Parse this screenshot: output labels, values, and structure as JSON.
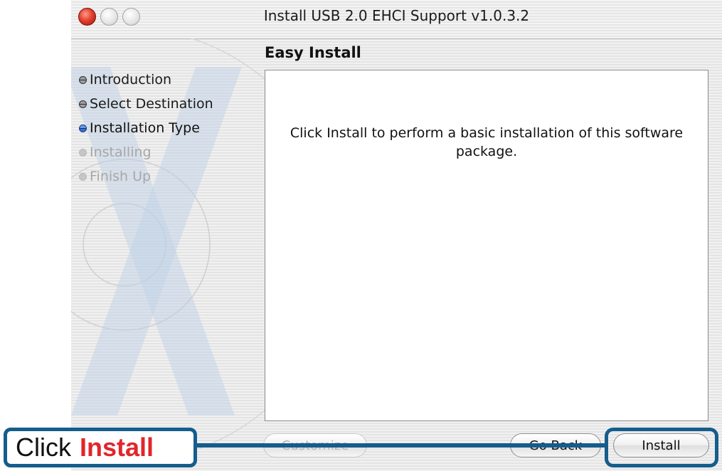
{
  "window": {
    "title": "Install USB 2.0 EHCI Support v1.0.3.2"
  },
  "pane": {
    "title": "Easy Install"
  },
  "steps": [
    {
      "label": "Introduction",
      "state": "done"
    },
    {
      "label": "Select Destination",
      "state": "done"
    },
    {
      "label": "Installation Type",
      "state": "current"
    },
    {
      "label": "Installing",
      "state": "pending"
    },
    {
      "label": "Finish Up",
      "state": "pending"
    }
  ],
  "content": {
    "message": "Click Install to perform a basic installation of this software package."
  },
  "buttons": {
    "customize": "Customize",
    "go_back": "Go Back",
    "install": "Install"
  },
  "callout": {
    "prefix": "Click",
    "highlight": "Install"
  },
  "colors": {
    "callout_border": "#155d8c",
    "callout_accent": "#e0262c",
    "close_button": "#e2402e",
    "current_step_bullet": "#3a6fcf"
  },
  "icons": {
    "close": "close-icon",
    "minimize": "minimize-icon",
    "zoom": "zoom-icon",
    "watermark": "mac-os-x-logo-icon"
  }
}
